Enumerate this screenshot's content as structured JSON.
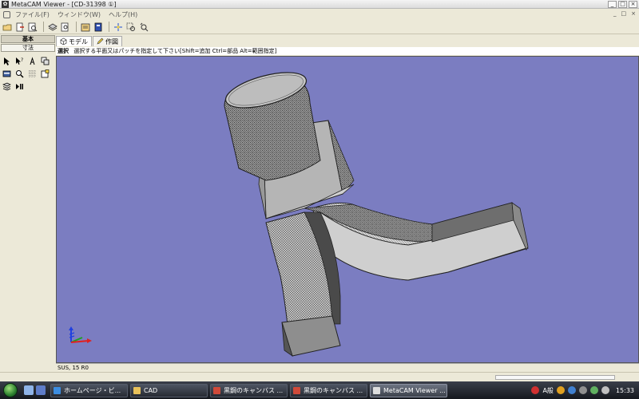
{
  "window": {
    "title": "MetaCAM Viewer - [CD-31398 ①]",
    "app_icon": "metacam-app-icon",
    "controls": [
      "minimize-button",
      "maximize-button",
      "close-button"
    ]
  },
  "menu": {
    "items": [
      "ファイル(F)",
      "ウィンドウ(W)",
      "ヘルプ(H)"
    ],
    "mdi_controls": [
      "_",
      "□",
      "×"
    ]
  },
  "toolbar": {
    "icons": [
      "open-icon",
      "export-icon",
      "print-preview-icon",
      "layers-icon",
      "find-icon",
      "properties-icon",
      "document-icon",
      "axis-snap-icon",
      "zoom-window-icon",
      "zoom-previous-icon"
    ]
  },
  "left_panel": {
    "tabs": [
      "基本",
      "寸法"
    ],
    "tools": [
      "select-arrow-icon",
      "query-arrow-icon",
      "pick-icon",
      "parts-icon",
      "panel-icon",
      "zoom-icon",
      "grid-icon",
      "note-icon",
      "layers-stack-icon",
      "play-icon"
    ]
  },
  "view_tabs": [
    {
      "label": "モデル",
      "icon": "cube-icon"
    },
    {
      "label": "作図",
      "icon": "pencil-icon"
    }
  ],
  "hint": {
    "mode": "選択",
    "text": "選択する平面又はパッチを指定して下さい[Shift=追加 Ctrl=部品 Alt=範囲指定]"
  },
  "viewport": {
    "background": "#7b7dc1",
    "axis_indicator": "xyz-axis-icon"
  },
  "status": {
    "material": "SUS, 15 R0"
  },
  "taskbar": {
    "tasks": [
      {
        "label": "ホームページ・ビ...",
        "icon_color": "#3c8de0"
      },
      {
        "label": "CAD",
        "icon_color": "#e8c15a"
      },
      {
        "label": "黒鋼のキャンバス ...",
        "icon_color": "#d04a3a"
      },
      {
        "label": "黒鋼のキャンバス ...",
        "icon_color": "#d04a3a"
      },
      {
        "label": "MetaCAM Viewer ...",
        "icon_color": "#dddddd"
      }
    ],
    "tray": {
      "ime": "A般",
      "clock": "15:33"
    }
  }
}
